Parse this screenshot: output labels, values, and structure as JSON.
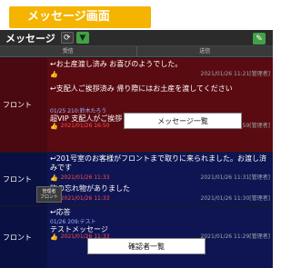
{
  "banner": {
    "title": "メッセージ画面"
  },
  "header": {
    "title": "メッセージ",
    "refresh_icon": "refresh-icon",
    "filter_icon": "filter-icon",
    "compose_icon": "compose-icon"
  },
  "tabs": [
    {
      "label": "受信"
    },
    {
      "label": "送信"
    }
  ],
  "rows": [
    {
      "sender": "フロント",
      "messages": [
        {
          "text": "↩お土産渡し済み お喜びのようでした。",
          "date": "2021/01/26 11:21[管理者]"
        },
        {
          "text": "↩支配人ご挨拶済み 帰り際にはお土産を渡してください",
          "sub": "01/25 210:鈴木たろう",
          "mid": "超VIP 支配人がご挨拶",
          "red": "2021/01/26 16:50",
          "date": "2021/01/26 11:59[管理者]"
        }
      ]
    },
    {
      "sender": "フロント",
      "messages": [
        {
          "text": "↩201号室のお客様がフロントまで取りに来られました。お渡し済みです",
          "red": "2021/01/26 11:33",
          "date": "2021/01/26 11:31[管理者]"
        },
        {
          "text": "物の忘れ物がありました",
          "red": "2021/01/26 11:33",
          "date": "2021/01/26 11:30[管理者]"
        }
      ]
    },
    {
      "sender": "フロント",
      "messages": [
        {
          "text": "↩応答",
          "sub": "01/26 209:テスト",
          "mid": "テストメッセージ",
          "red": "2021/01/26 11:33",
          "date": "2021/01/26 11:29[管理者]"
        }
      ]
    }
  ],
  "callouts": {
    "message_list": "メッセージ一覧",
    "confirmer_list": "確認者一覧"
  },
  "tooltip": {
    "line1": "管理者",
    "line2": "フロント"
  }
}
